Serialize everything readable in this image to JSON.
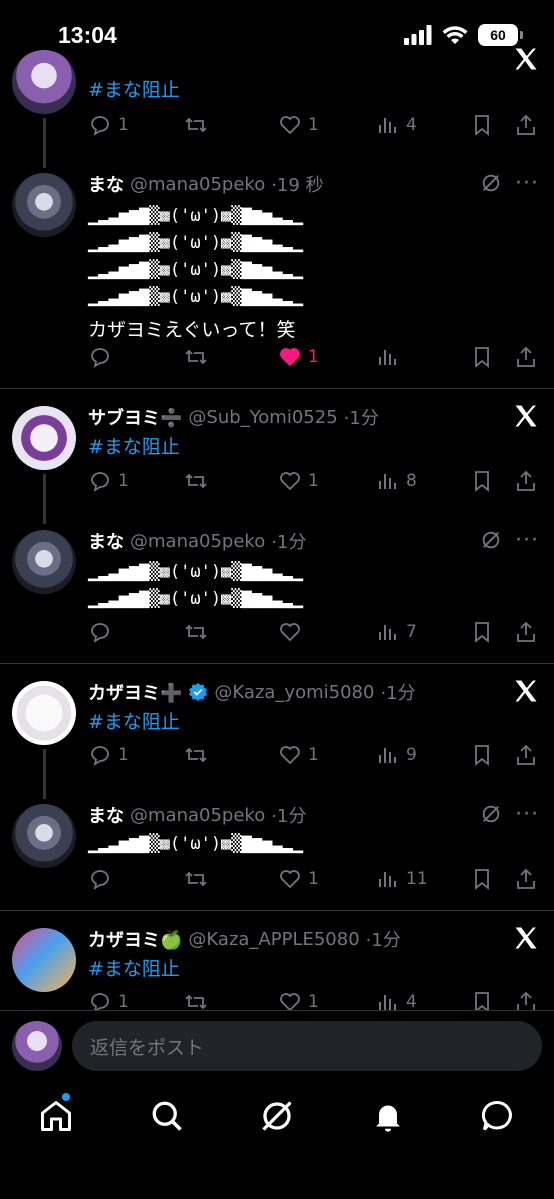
{
  "status": {
    "time": "13:04",
    "battery": "60"
  },
  "posts": [
    {
      "id": "top",
      "hashtag": "#まな阻止",
      "reply": "1",
      "retweet": "",
      "like": "1",
      "views": "4"
    },
    {
      "id": "mana1",
      "name": "まな",
      "handle": "@mana05peko",
      "time": "·19 秒",
      "kao": [
        "▁▂▃▅▆▇▒▩('ω')▩▒▇▆▅▃▂▁",
        "▁▂▃▅▆▇▒▩('ω')▩▒▇▆▅▃▂▁",
        "▁▂▃▅▆▇▒▩('ω')▩▒▇▆▅▃▂▁",
        "▁▂▃▅▆▇▒▩('ω')▩▒▇▆▅▃▂▁"
      ],
      "text": "カザヨミえぐいって！笑",
      "reply": "",
      "retweet": "",
      "like": "1",
      "views": ""
    },
    {
      "id": "sabu",
      "name": "サブヨミ➗",
      "handle": "@Sub_Yomi0525",
      "time": "·1分",
      "hashtag": "#まな阻止",
      "reply": "1",
      "retweet": "",
      "like": "1",
      "views": "8"
    },
    {
      "id": "mana2",
      "name": "まな",
      "handle": "@mana05peko",
      "time": "·1分",
      "kao": [
        "▁▂▃▅▆▇▒▩('ω')▩▒▇▆▅▃▂▁",
        "▁▂▃▅▆▇▒▩('ω')▩▒▇▆▅▃▂▁"
      ],
      "reply": "",
      "retweet": "",
      "like": "",
      "views": "7"
    },
    {
      "id": "kaza",
      "name": "カザヨミ➕",
      "handle": "@Kaza_yomi5080",
      "time": "·1分",
      "hashtag": "#まな阻止",
      "reply": "1",
      "retweet": "",
      "like": "1",
      "views": "9"
    },
    {
      "id": "mana3",
      "name": "まな",
      "handle": "@mana05peko",
      "time": "·1分",
      "kao": [
        "▁▂▃▅▆▇▒▩('ω')▩▒▇▆▅▃▂▁"
      ],
      "reply": "",
      "retweet": "",
      "like": "1",
      "views": "11"
    },
    {
      "id": "apple",
      "name": "カザヨミ🍏",
      "handle": "@Kaza_APPLE5080",
      "time": "·1分",
      "hashtag": "#まな阻止",
      "reply": "1",
      "retweet": "",
      "like": "1",
      "views": "4"
    }
  ],
  "reply_bar": {
    "placeholder": "返信をポスト"
  },
  "colors": {
    "accent": "#1d9bf0",
    "like_active": "#f91880",
    "muted": "#71767b"
  },
  "icons": [
    "reply-icon",
    "retweet-icon",
    "like-icon",
    "views-icon",
    "bookmark-icon",
    "share-icon",
    "x-logo-icon",
    "grok-icon",
    "more-icon",
    "home-icon",
    "search-icon",
    "bell-icon",
    "messages-icon",
    "verified-badge-icon"
  ]
}
